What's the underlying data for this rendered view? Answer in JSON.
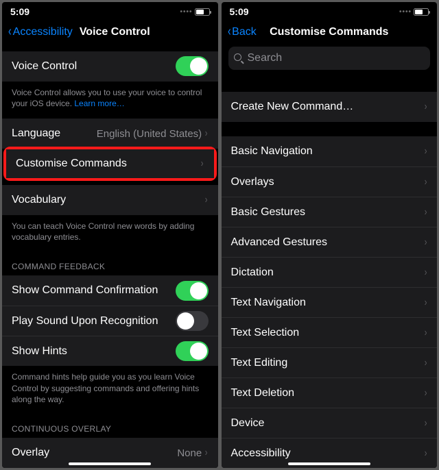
{
  "status": {
    "time": "5:09"
  },
  "left": {
    "back": "Accessibility",
    "title": "Voice Control",
    "vc_label": "Voice Control",
    "vc_desc_a": "Voice Control allows you to use your voice to control your iOS device. ",
    "vc_learn": "Learn more…",
    "language_label": "Language",
    "language_value": "English (United States)",
    "customise_label": "Customise Commands",
    "vocab_label": "Vocabulary",
    "vocab_desc": "You can teach Voice Control new words by adding vocabulary entries.",
    "feedback_header": "COMMAND FEEDBACK",
    "show_confirm_label": "Show Command Confirmation",
    "play_sound_label": "Play Sound Upon Recognition",
    "show_hints_label": "Show Hints",
    "hints_desc": "Command hints help guide you as you learn Voice Control by suggesting commands and offering hints along the way.",
    "overlay_header": "CONTINUOUS OVERLAY",
    "overlay_label": "Overlay",
    "overlay_value": "None"
  },
  "right": {
    "back": "Back",
    "title": "Customise Commands",
    "search_placeholder": "Search",
    "create_label": "Create New Command…",
    "categories": [
      "Basic Navigation",
      "Overlays",
      "Basic Gestures",
      "Advanced Gestures",
      "Dictation",
      "Text Navigation",
      "Text Selection",
      "Text Editing",
      "Text Deletion",
      "Device",
      "Accessibility"
    ]
  }
}
